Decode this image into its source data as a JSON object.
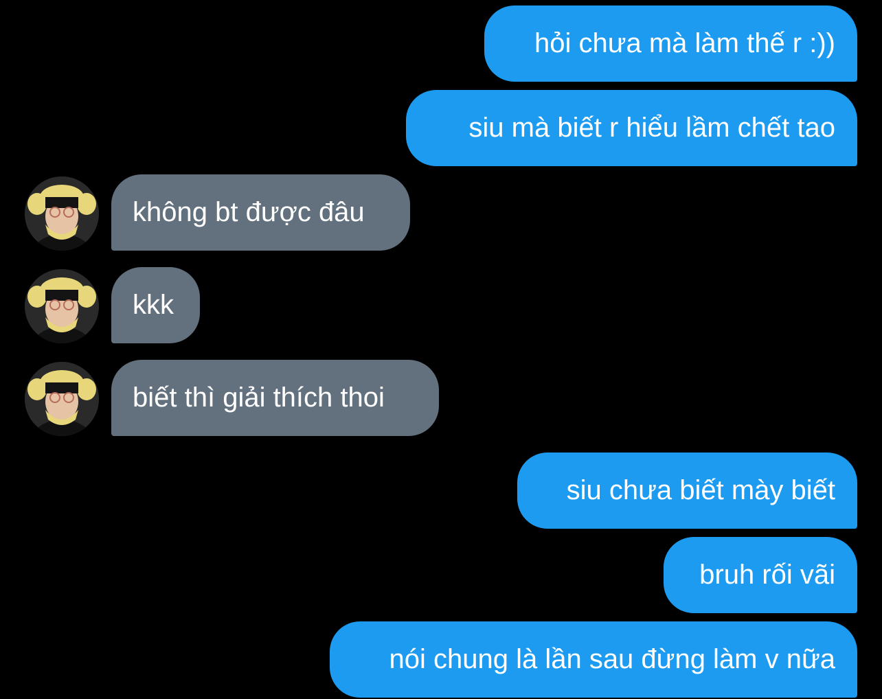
{
  "colors": {
    "background": "#000000",
    "sent_bubble": "#1d9bf0",
    "received_bubble": "#63717f",
    "text": "#ffffff"
  },
  "messages": [
    {
      "direction": "sent",
      "text": "hỏi chưa mà làm thế r :))"
    },
    {
      "direction": "sent",
      "text": "siu mà biết r hiểu lầm chết tao"
    },
    {
      "direction": "received",
      "text": "không bt được đâu",
      "avatar_icon": "user-avatar-icon"
    },
    {
      "direction": "received",
      "text": "kkk",
      "avatar_icon": "user-avatar-icon"
    },
    {
      "direction": "received",
      "text": "biết thì giải thích thoi",
      "avatar_icon": "user-avatar-icon"
    },
    {
      "direction": "sent",
      "text": "siu chưa biết mày biết"
    },
    {
      "direction": "sent",
      "text": "bruh rối vãi"
    },
    {
      "direction": "sent",
      "text": "nói chung là lần sau đừng làm v nữa"
    }
  ]
}
